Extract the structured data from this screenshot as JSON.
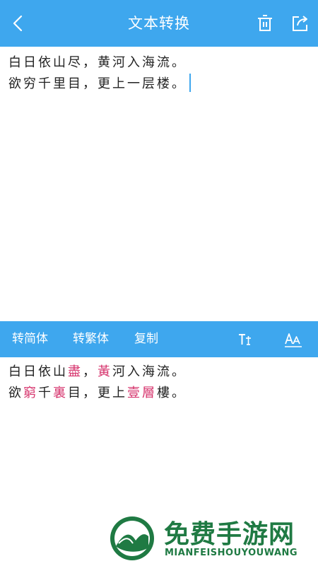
{
  "header": {
    "title": "文本转换",
    "back_icon": "chevron-left-icon",
    "delete_icon": "trash-icon",
    "share_icon": "share-icon"
  },
  "input": {
    "lines": [
      "白日依山尽，黄河入海流。",
      "欲穷千里目，更上一层楼。"
    ]
  },
  "toolbar": {
    "to_simplified": "转简体",
    "to_traditional": "转繁体",
    "copy": "复制",
    "text_size_icon": "text-size-icon",
    "font_icon": "font-style-icon"
  },
  "output": {
    "line1": [
      {
        "text": "白日依山",
        "highlight": false
      },
      {
        "text": "盡",
        "highlight": true
      },
      {
        "text": "，",
        "highlight": false
      },
      {
        "text": "黃",
        "highlight": true
      },
      {
        "text": "河入海流。",
        "highlight": false
      }
    ],
    "line2": [
      {
        "text": "欲",
        "highlight": false
      },
      {
        "text": "窮",
        "highlight": true
      },
      {
        "text": "千",
        "highlight": false
      },
      {
        "text": "裏",
        "highlight": true
      },
      {
        "text": "目，更上",
        "highlight": false
      },
      {
        "text": "壹層",
        "highlight": true
      },
      {
        "text": "樓。",
        "highlight": false
      }
    ]
  },
  "watermark": {
    "title": "免费手游网",
    "subtitle": "MIANFEISHOUYOUWANG"
  },
  "colors": {
    "primary": "#3ea7ee",
    "highlight": "#d6336c",
    "watermark": "#1f7a43"
  }
}
